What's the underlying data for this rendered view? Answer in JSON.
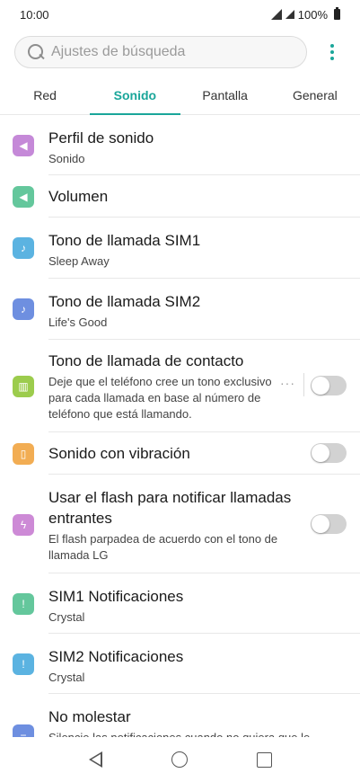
{
  "status": {
    "time": "10:00",
    "battery": "100%"
  },
  "search": {
    "placeholder": "Ajustes de búsqueda"
  },
  "tabs": [
    {
      "label": "Red",
      "active": false
    },
    {
      "label": "Sonido",
      "active": true
    },
    {
      "label": "Pantalla",
      "active": false
    },
    {
      "label": "General",
      "active": false
    }
  ],
  "items": [
    {
      "title": "Perfil de sonido",
      "subtitle": "Sonido",
      "icon": "speaker-icon",
      "color": "#c589d8"
    },
    {
      "title": "Volumen",
      "icon": "volume-icon",
      "color": "#64c79c"
    },
    {
      "title": "Tono de llamada SIM1",
      "subtitle": "Sleep Away",
      "icon": "music-note-icon",
      "color": "#5bb3e1"
    },
    {
      "title": "Tono de llamada SIM2",
      "subtitle": "Life's Good",
      "icon": "music-note-icon",
      "color": "#6e8fe0"
    },
    {
      "title": "Tono de llamada de contacto",
      "subtitle": "Deje que el teléfono cree un tono exclusivo para cada llamada en base al número de teléfono que está llamando.",
      "icon": "piano-icon",
      "color": "#9ccc4d",
      "toggle": false,
      "more": "···"
    },
    {
      "title": "Sonido con vibración",
      "icon": "vibration-icon",
      "color": "#f2ad53",
      "toggle": false
    },
    {
      "title": "Usar el flash para notificar llamadas entrantes",
      "subtitle": "El flash parpadea de acuerdo con el tono de llamada LG",
      "icon": "flash-icon",
      "color": "#cd8ad6",
      "toggle": false
    },
    {
      "title": "SIM1 Notificaciones",
      "subtitle": "Crystal",
      "icon": "alert-icon",
      "color": "#64c79c"
    },
    {
      "title": "SIM2 Notificaciones",
      "subtitle": "Crystal",
      "icon": "alert-icon",
      "color": "#5bb3e1"
    },
    {
      "title": "No molestar",
      "subtitle": "Silencie las notificaciones cuando no quiera que le",
      "icon": "minus-circle-icon",
      "color": "#6e8fe0"
    }
  ]
}
